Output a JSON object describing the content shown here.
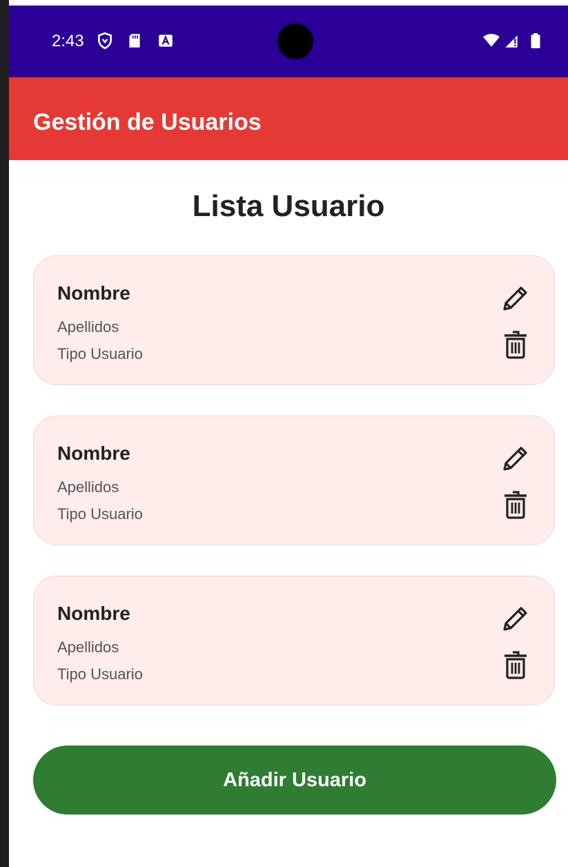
{
  "status_bar": {
    "time": "2:43",
    "left_icons": [
      "shield-icon",
      "sd-card-icon",
      "keyboard-a-icon"
    ],
    "right_icons": [
      "wifi-icon",
      "signal-icon",
      "battery-icon"
    ]
  },
  "app_bar": {
    "title": "Gestión de Usuarios",
    "color": "#e53935"
  },
  "main": {
    "title": "Lista Usuario",
    "users": [
      {
        "name": "Nombre",
        "surname": "Apellidos",
        "type": "Tipo Usuario"
      },
      {
        "name": "Nombre",
        "surname": "Apellidos",
        "type": "Tipo Usuario"
      },
      {
        "name": "Nombre",
        "surname": "Apellidos",
        "type": "Tipo Usuario"
      }
    ],
    "card_actions": [
      "pencil-icon",
      "trash-icon"
    ],
    "add_button_label": "Añadir Usuario",
    "add_button_color": "#2e7d32"
  },
  "colors": {
    "status_bar": "#2a0096",
    "card_background": "#ffeceb"
  }
}
